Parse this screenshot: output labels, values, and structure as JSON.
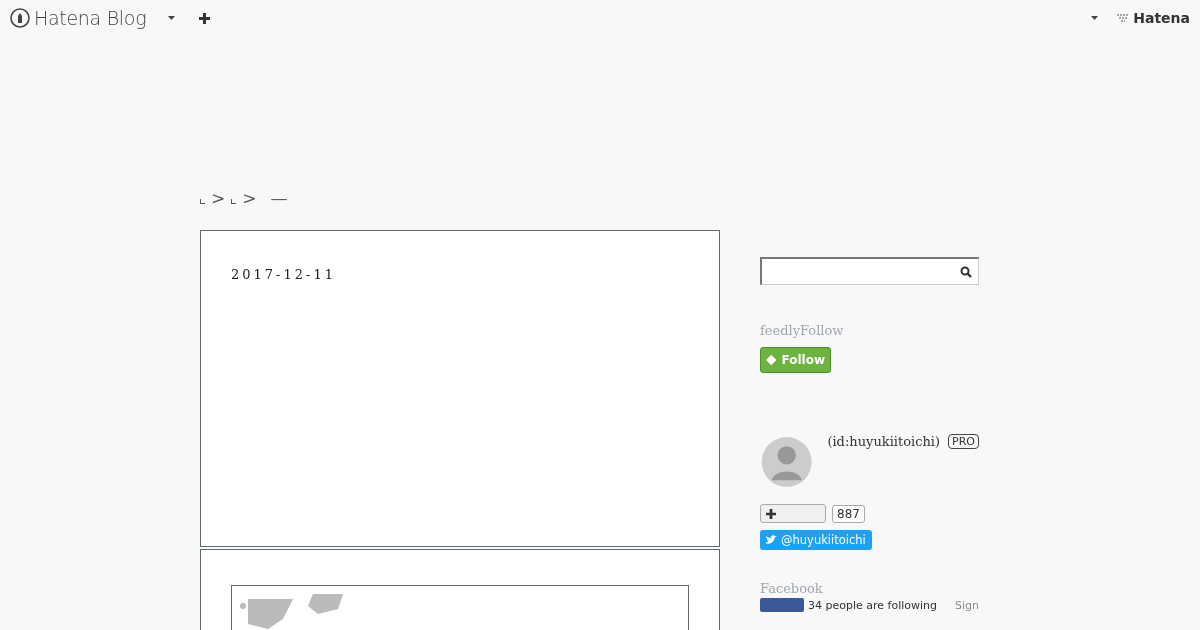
{
  "header": {
    "logo": "Hatena Blog",
    "brand": "Hatena"
  },
  "breadcrumb": {
    "separators": [
      ">",
      ">"
    ],
    "current": "—"
  },
  "entry": {
    "date": "2017-12-11"
  },
  "sidebar": {
    "feedly": {
      "title": "feedlyFollow",
      "button": "Follow"
    },
    "profile": {
      "id": "(id:huyukiitoichi)",
      "badge": "PRO",
      "count": "887",
      "twitter": "@huyukiitoichi"
    },
    "facebook": {
      "title": "Facebook",
      "followers": "34 people are following",
      "link": "Sign"
    }
  }
}
